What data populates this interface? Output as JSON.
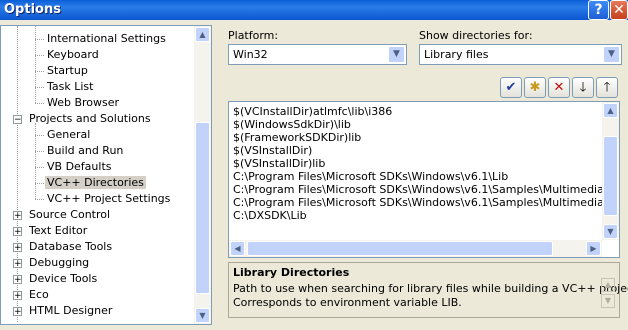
{
  "window": {
    "title": "Options",
    "help_glyph": "?",
    "close_glyph": "✕"
  },
  "tree": {
    "items": [
      {
        "label": "International Settings",
        "level": 1
      },
      {
        "label": "Keyboard",
        "level": 1
      },
      {
        "label": "Startup",
        "level": 1
      },
      {
        "label": "Task List",
        "level": 1
      },
      {
        "label": "Web Browser",
        "level": 1
      },
      {
        "label": "Projects and Solutions",
        "level": 0,
        "expander": "−"
      },
      {
        "label": "General",
        "level": 1
      },
      {
        "label": "Build and Run",
        "level": 1
      },
      {
        "label": "VB Defaults",
        "level": 1
      },
      {
        "label": "VC++ Directories",
        "level": 1,
        "selected": true
      },
      {
        "label": "VC++ Project Settings",
        "level": 1
      },
      {
        "label": "Source Control",
        "level": 0,
        "expander": "+"
      },
      {
        "label": "Text Editor",
        "level": 0,
        "expander": "+"
      },
      {
        "label": "Database Tools",
        "level": 0,
        "expander": "+"
      },
      {
        "label": "Debugging",
        "level": 0,
        "expander": "+"
      },
      {
        "label": "Device Tools",
        "level": 0,
        "expander": "+"
      },
      {
        "label": "Eco",
        "level": 0,
        "expander": "+"
      },
      {
        "label": "HTML Designer",
        "level": 0,
        "expander": "+"
      }
    ]
  },
  "platform": {
    "label": "Platform:",
    "value": "Win32"
  },
  "show_dirs": {
    "label": "Show directories for:",
    "value": "Library files"
  },
  "toolbar": {
    "check": "✔",
    "new_folder": "✱",
    "delete": "✕",
    "down": "🡓",
    "up": "🡑"
  },
  "directories": [
    "$(VCInstallDir)atlmfc\\lib\\i386",
    "$(WindowsSdkDir)\\lib",
    "$(FrameworkSDKDir)lib",
    "$(VSInstallDir)",
    "$(VSInstallDir)lib",
    "C:\\Program Files\\Microsoft SDKs\\Windows\\v6.1\\Lib",
    "C:\\Program Files\\Microsoft SDKs\\Windows\\v6.1\\Samples\\Multimedia\\DirectSh",
    "C:\\Program Files\\Microsoft SDKs\\Windows\\v6.1\\Samples\\Multimedia\\DirectSh",
    "C:\\DXSDK\\Lib"
  ],
  "description": {
    "title": "Library Directories",
    "line1": "Path to use when searching for library files while building a VC++ project.",
    "line2": "Corresponds to environment variable LIB."
  },
  "colors": {
    "titlebar": "#0a5fd8",
    "window_bg": "#ece9d8",
    "selection": "#d4d0c8"
  }
}
